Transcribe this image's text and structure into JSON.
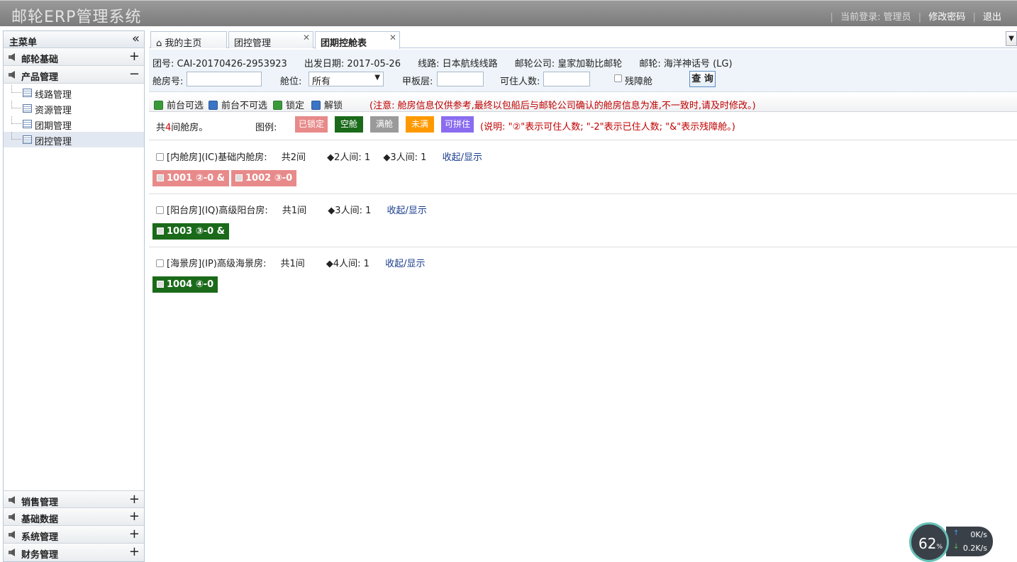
{
  "header": {
    "app_title": "邮轮ERP管理系统",
    "login_label": "当前登录:",
    "user": "管理员",
    "change_password": "修改密码",
    "logout": "退出"
  },
  "sidebar": {
    "title": "主菜单",
    "groups_top": [
      {
        "label": "邮轮基础",
        "toggle": "+"
      },
      {
        "label": "产品管理",
        "toggle": "−"
      }
    ],
    "tree_items": [
      "线路管理",
      "资源管理",
      "团期管理",
      "团控管理"
    ],
    "groups_bottom": [
      {
        "label": "销售管理",
        "toggle": "+"
      },
      {
        "label": "基础数据",
        "toggle": "+"
      },
      {
        "label": "系统管理",
        "toggle": "+"
      },
      {
        "label": "财务管理",
        "toggle": "+"
      }
    ]
  },
  "tabs": [
    {
      "label": "我的主页"
    },
    {
      "label": "团控管理"
    },
    {
      "label": "团期控舱表"
    }
  ],
  "info": {
    "group_no": "团号: CAI-20170426-2953923",
    "depart_date": "出发日期: 2017-05-26",
    "route": "线路: 日本航线线路",
    "cruise_company": "邮轮公司: 皇家加勒比邮轮",
    "ship": "邮轮: 海洋神话号 (LG)"
  },
  "filters": {
    "cabin_no_label": "舱房号:",
    "berth_label": "舱位:",
    "berth_value": "所有",
    "deck_label": "甲板层:",
    "capacity_label": "可住人数:",
    "disabled_label": "残障舱",
    "query_button": "查 询"
  },
  "toolbar": {
    "front_available": "前台可选",
    "front_unavailable": "前台不可选",
    "lock": "锁定",
    "unlock": "解锁",
    "note": "(注意: 舱房信息仅供参考,最终以包船后与邮轮公司确认的舱房信息为准,不一致时,请及时修改。)"
  },
  "summary": {
    "total_prefix": "共",
    "total_num": "4",
    "total_suffix": "间舱房。",
    "legend_label": "图例:",
    "legend": [
      {
        "label": "已锁定",
        "color": "#e88a8a"
      },
      {
        "label": "空舱",
        "color": "#1a6a1a"
      },
      {
        "label": "满舱",
        "color": "#9a9a9a"
      },
      {
        "label": "未满",
        "color": "#ff9900"
      },
      {
        "label": "可拼住",
        "color": "#8a6cf0"
      }
    ],
    "legend_note": "(说明: \"②\"表示可住人数; \"-2\"表示已住人数; \"&\"表示残障舱。)"
  },
  "sections": [
    {
      "title": "[内舱房](IC)基础内舱房:",
      "count": "共2间",
      "details": [
        "◆2人间: 1",
        "◆3人间: 1"
      ],
      "toggle": "收起/显示",
      "rooms": [
        {
          "label": "1001 ②-0 &",
          "status": "已锁定"
        },
        {
          "label": "1002 ③-0",
          "status": "已锁定"
        }
      ]
    },
    {
      "title": "[阳台房](IQ)高级阳台房:",
      "count": "共1间",
      "details": [
        "◆3人间: 1"
      ],
      "toggle": "收起/显示",
      "rooms": [
        {
          "label": "1003 ③-0 &",
          "status": "空舱"
        }
      ]
    },
    {
      "title": "[海景房](IP)高级海景房:",
      "count": "共1间",
      "details": [
        "◆4人间: 1"
      ],
      "toggle": "收起/显示",
      "rooms": [
        {
          "label": "1004 ④-0",
          "status": "空舱"
        }
      ]
    }
  ],
  "widget": {
    "percent": "62",
    "percent_unit": "%",
    "upload": "0K/s",
    "download": "0.2K/s"
  }
}
